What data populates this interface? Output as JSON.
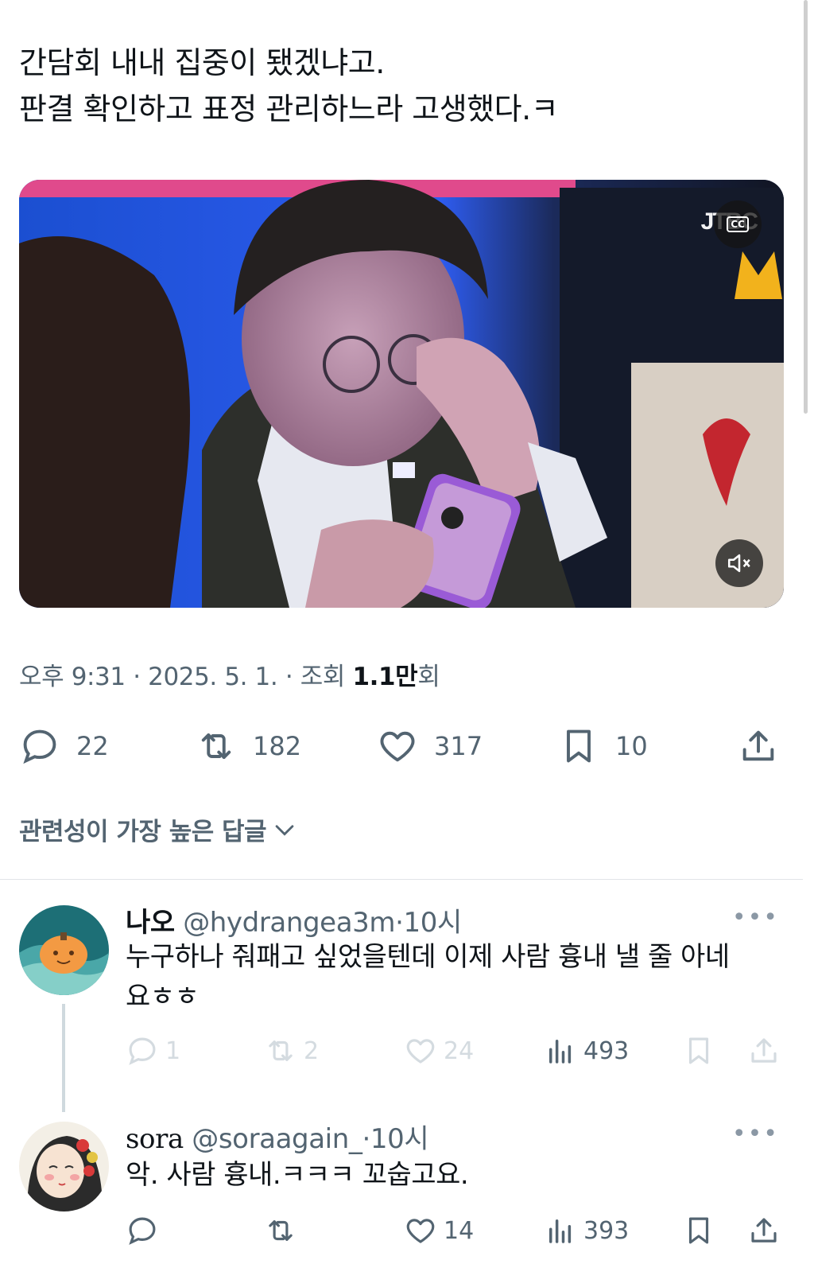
{
  "tweet": {
    "line1": "간담회 내내 집중이 됐겠냐고.",
    "line2": "판결 확인하고 표정 관리하느라 고생했다.ㅋ",
    "media": {
      "logo": "JTBC",
      "cc_icon": "CC",
      "mute_icon": "speaker-mute-icon"
    },
    "time": "오후 9:31",
    "date": "2025. 5. 1.",
    "views_label": "조회",
    "views_value": "1.1만",
    "views_suffix": "회",
    "sep": "·",
    "stats": {
      "replies": "22",
      "retweets": "182",
      "likes": "317",
      "bookmarks": "10"
    }
  },
  "sort_label": "관련성이 가장 높은 답글",
  "replies": [
    {
      "name": "나오",
      "handle": "@hydrangea3m",
      "time": "10시",
      "text_line1": "누구하나 줘패고 싶었을텐데 이제 사람 흉내 낼 줄 아네",
      "text_line2": "요ㅎㅎ",
      "stats": {
        "replies": "1",
        "retweets": "2",
        "likes": "24",
        "views": "493"
      }
    },
    {
      "name": "sora",
      "handle": "@soraagain_",
      "time": "10시",
      "text_line1": "악. 사람 흉내.ㅋㅋㅋ 꼬숩고요.",
      "stats": {
        "likes": "14",
        "views": "393"
      }
    }
  ],
  "colors": {
    "text": "#0f1419",
    "secondary": "#536471",
    "faded": "#d4dbe0",
    "divider": "#e1e4e8"
  }
}
